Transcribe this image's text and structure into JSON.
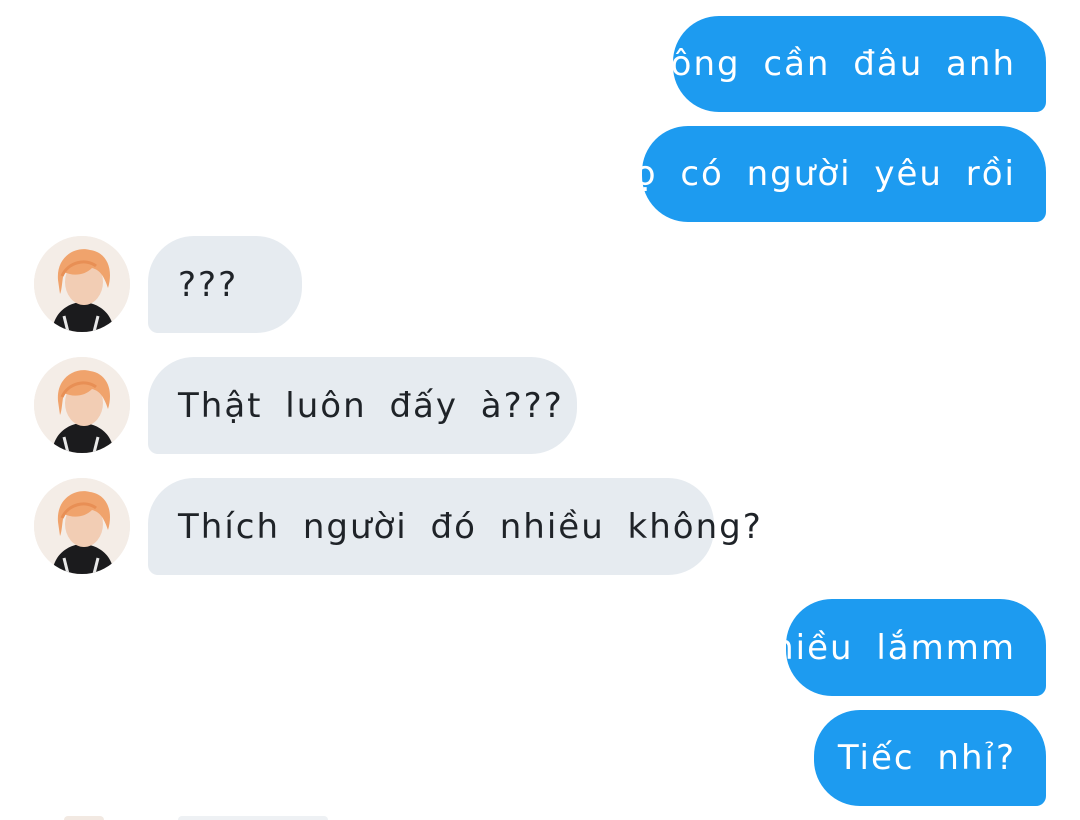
{
  "messages": [
    {
      "side": "sent",
      "text": "Không cần đâu anh"
    },
    {
      "side": "sent",
      "text": "Họ có người yêu rồi"
    },
    {
      "side": "received",
      "text": "???"
    },
    {
      "side": "received",
      "text": "Thật luôn đấy à???"
    },
    {
      "side": "received",
      "text": "Thích người đó nhiều không?"
    },
    {
      "side": "sent",
      "text": "Nhiều lắmmm"
    },
    {
      "side": "sent",
      "text": "Tiếc nhỉ?"
    }
  ],
  "colors": {
    "sent_bubble": "#1d9bf0",
    "received_bubble": "#e6ebf0",
    "sent_text": "#ffffff",
    "received_text": "#1f2328"
  }
}
